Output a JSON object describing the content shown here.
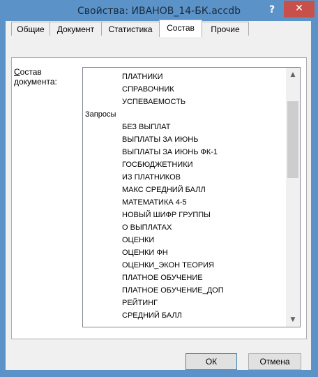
{
  "window": {
    "title": "Свойства: ИВАНОВ_14-БК.accdb",
    "help_glyph": "?",
    "close_glyph": "✕"
  },
  "tabs": [
    {
      "label": "Общие",
      "active": false
    },
    {
      "label": "Документ",
      "active": false
    },
    {
      "label": "Статистика",
      "active": false
    },
    {
      "label": "Состав",
      "active": true
    },
    {
      "label": "Прочие",
      "active": false
    }
  ],
  "panel": {
    "label_accel": "С",
    "label_rest": "остав",
    "label_line2": "документа:",
    "items": [
      {
        "text": "ПЛАТНИКИ",
        "group": false
      },
      {
        "text": "СПРАВОЧНИК",
        "group": false
      },
      {
        "text": "УСПЕВАЕМОСТЬ",
        "group": false
      },
      {
        "text": "Запросы",
        "group": true
      },
      {
        "text": "БЕЗ ВЫПЛАТ",
        "group": false
      },
      {
        "text": "ВЫПЛАТЫ ЗА ИЮНЬ",
        "group": false
      },
      {
        "text": "ВЫПЛАТЫ ЗА ИЮНЬ ФК-1",
        "group": false
      },
      {
        "text": "ГОСБЮДЖЕТНИКИ",
        "group": false
      },
      {
        "text": "ИЗ ПЛАТНИКОВ",
        "group": false
      },
      {
        "text": "МАКС СРЕДНИЙ БАЛЛ",
        "group": false
      },
      {
        "text": "МАТЕМАТИКА 4-5",
        "group": false
      },
      {
        "text": "НОВЫЙ ШИФР ГРУППЫ",
        "group": false
      },
      {
        "text": "О ВЫПЛАТАХ",
        "group": false
      },
      {
        "text": "ОЦЕНКИ",
        "group": false
      },
      {
        "text": "ОЦЕНКИ ФН",
        "group": false
      },
      {
        "text": "ОЦЕНКИ_ЭКОН ТЕОРИЯ",
        "group": false
      },
      {
        "text": "ПЛАТНОЕ ОБУЧЕНИЕ",
        "group": false
      },
      {
        "text": "ПЛАТНОЕ ОБУЧЕНИЕ_ДОП",
        "group": false
      },
      {
        "text": "РЕЙТИНГ",
        "group": false
      },
      {
        "text": "СРЕДНИЙ БАЛЛ",
        "group": false
      }
    ]
  },
  "buttons": {
    "ok": "ОК",
    "cancel": "Отмена"
  }
}
